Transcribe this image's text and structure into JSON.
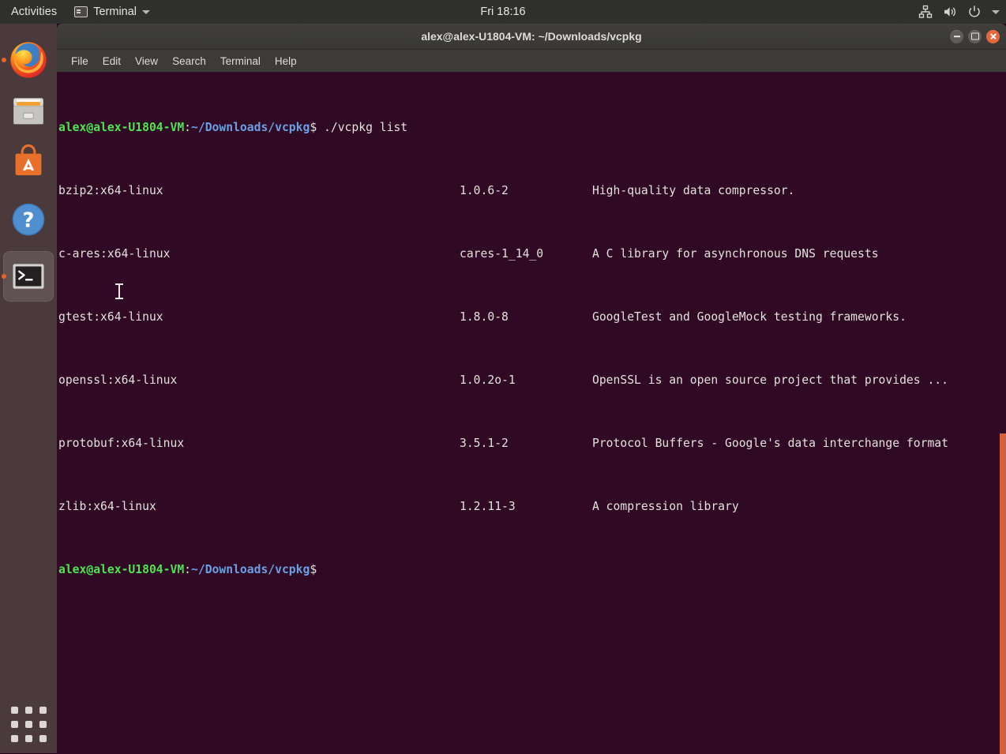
{
  "topbar": {
    "activities": "Activities",
    "app_name": "Terminal",
    "app_icon": "terminal-icon",
    "app_caret": "chevron-down-icon",
    "clock": "Fri 18:16",
    "indicators": [
      {
        "name": "network-icon"
      },
      {
        "name": "volume-icon"
      },
      {
        "name": "power-icon"
      },
      {
        "name": "chevron-down-icon"
      }
    ]
  },
  "dock": {
    "items": [
      {
        "name": "firefox",
        "label": "Firefox Web Browser",
        "active": false,
        "running": true
      },
      {
        "name": "files",
        "label": "Files",
        "active": false,
        "running": false
      },
      {
        "name": "ubuntu-software",
        "label": "Ubuntu Software",
        "active": false,
        "running": false
      },
      {
        "name": "help",
        "label": "Help",
        "active": false,
        "running": false
      },
      {
        "name": "terminal",
        "label": "Terminal",
        "active": true,
        "running": true
      }
    ],
    "show_applications": "Show Applications"
  },
  "window": {
    "title": "alex@alex-U1804-VM: ~/Downloads/vcpkg",
    "controls": {
      "minimize": "minimize-button",
      "maximize": "maximize-button",
      "close": "close-button"
    },
    "menu": [
      "File",
      "Edit",
      "View",
      "Search",
      "Terminal",
      "Help"
    ]
  },
  "terminal": {
    "colors": {
      "background": "#300a24",
      "foreground": "#e3e0dc",
      "user_host": "#4ee44e",
      "path": "#6b9fe3",
      "scrollbar": "#d4613c"
    },
    "prompt_user": "alex@alex-U1804-VM",
    "prompt_sep": ":",
    "prompt_path": "~/Downloads/vcpkg",
    "prompt_sigil": "$",
    "command": " ./vcpkg list",
    "packages": [
      {
        "package": "bzip2:x64-linux",
        "version": "1.0.6-2",
        "description": "High-quality data compressor."
      },
      {
        "package": "c-ares:x64-linux",
        "version": "cares-1_14_0",
        "description": "A C library for asynchronous DNS requests"
      },
      {
        "package": "gtest:x64-linux",
        "version": "1.8.0-8",
        "description": "GoogleTest and GoogleMock testing frameworks."
      },
      {
        "package": "openssl:x64-linux",
        "version": "1.0.2o-1",
        "description": "OpenSSL is an open source project that provides ..."
      },
      {
        "package": "protobuf:x64-linux",
        "version": "3.5.1-2",
        "description": "Protocol Buffers - Google's data interchange format"
      },
      {
        "package": "zlib:x64-linux",
        "version": "1.2.11-3",
        "description": "A compression library"
      }
    ],
    "cursor": "text-ibeam-cursor"
  }
}
